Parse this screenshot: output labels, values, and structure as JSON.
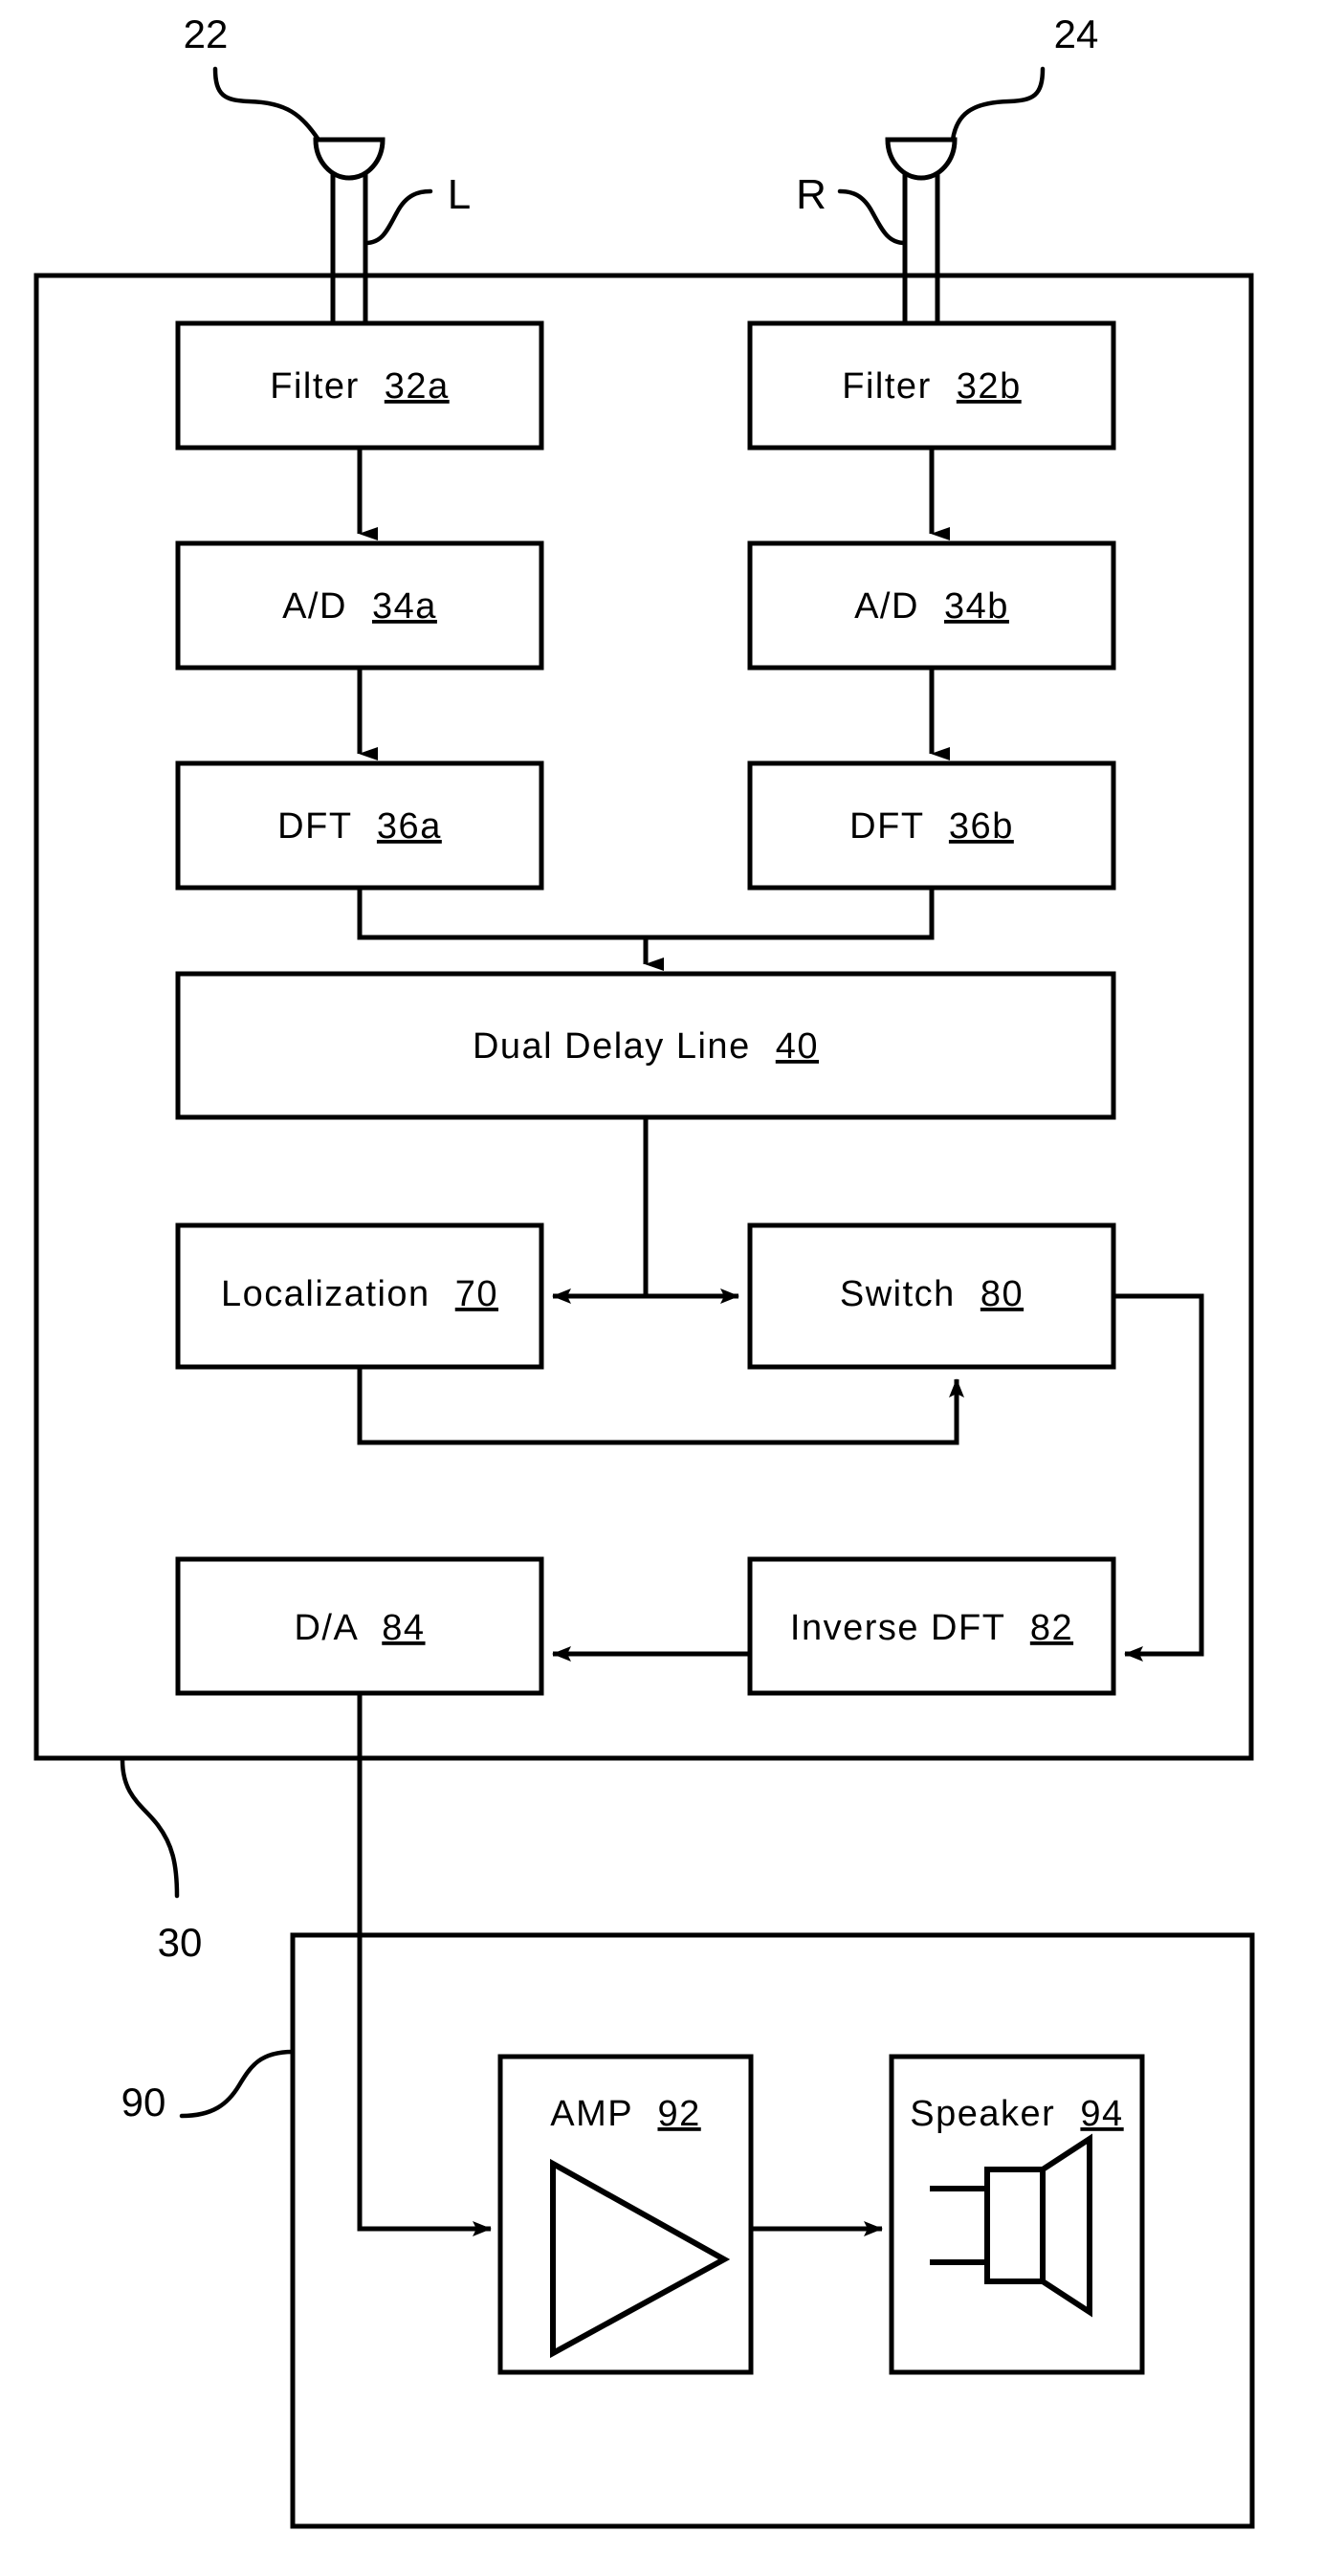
{
  "figure": {
    "type": "patent-block-diagram",
    "background_color": "#ffffff",
    "line_color": "#000000"
  },
  "inputs": {
    "left_mic": {
      "ref": "22",
      "channel": "L"
    },
    "right_mic": {
      "ref": "24",
      "channel": "R"
    }
  },
  "enclosures": {
    "processor": {
      "ref": "30"
    },
    "output_stage": {
      "ref": "90"
    }
  },
  "blocks": {
    "filter_a": {
      "name": "Filter",
      "num": "32a"
    },
    "filter_b": {
      "name": "Filter",
      "num": "32b"
    },
    "ad_a": {
      "name": "A/D",
      "num": "34a"
    },
    "ad_b": {
      "name": "A/D",
      "num": "34b"
    },
    "dft_a": {
      "name": "DFT",
      "num": "36a"
    },
    "dft_b": {
      "name": "DFT",
      "num": "36b"
    },
    "dual_delay_line": {
      "name": "Dual Delay Line",
      "num": "40"
    },
    "localization": {
      "name": "Localization",
      "num": "70"
    },
    "switch": {
      "name": "Switch",
      "num": "80"
    },
    "inverse_dft": {
      "name": "Inverse DFT",
      "num": "82"
    },
    "da": {
      "name": "D/A",
      "num": "84"
    },
    "amp": {
      "name": "AMP",
      "num": "92"
    },
    "speaker": {
      "name": "Speaker",
      "num": "94"
    }
  }
}
